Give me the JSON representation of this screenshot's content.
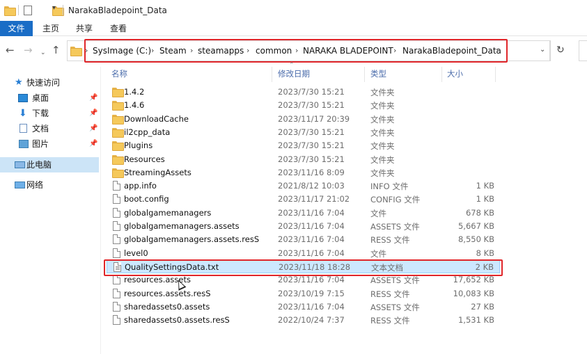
{
  "window": {
    "title": "NarakaBladepoint_Data"
  },
  "ribbon": {
    "tabs": [
      "文件",
      "主页",
      "共享",
      "查看"
    ]
  },
  "address": {
    "crumbs": [
      "SysImage (C:)",
      "Steam",
      "steamapps",
      "common",
      "NARAKA BLADEPOINT",
      "NarakaBladepoint_Data"
    ]
  },
  "sidebar": {
    "quick_access": "快速访问",
    "items": [
      {
        "label": "桌面",
        "pinned": true,
        "icon": "desktop-icon"
      },
      {
        "label": "下载",
        "pinned": true,
        "icon": "download-icon"
      },
      {
        "label": "文档",
        "pinned": true,
        "icon": "document-icon"
      },
      {
        "label": "图片",
        "pinned": true,
        "icon": "picture-icon"
      }
    ],
    "this_pc": "此电脑",
    "network": "网络"
  },
  "columns": {
    "name": "名称",
    "date": "修改日期",
    "type": "类型",
    "size": "大小"
  },
  "files": [
    {
      "name": "1.4.2",
      "date": "2023/7/30 15:21",
      "type": "文件夹",
      "size": "",
      "kind": "folder"
    },
    {
      "name": "1.4.6",
      "date": "2023/7/30 15:21",
      "type": "文件夹",
      "size": "",
      "kind": "folder"
    },
    {
      "name": "DownloadCache",
      "date": "2023/11/17 20:39",
      "type": "文件夹",
      "size": "",
      "kind": "folder"
    },
    {
      "name": "il2cpp_data",
      "date": "2023/7/30 15:21",
      "type": "文件夹",
      "size": "",
      "kind": "folder"
    },
    {
      "name": "Plugins",
      "date": "2023/7/30 15:21",
      "type": "文件夹",
      "size": "",
      "kind": "folder"
    },
    {
      "name": "Resources",
      "date": "2023/7/30 15:21",
      "type": "文件夹",
      "size": "",
      "kind": "folder"
    },
    {
      "name": "StreamingAssets",
      "date": "2023/11/16 8:09",
      "type": "文件夹",
      "size": "",
      "kind": "folder"
    },
    {
      "name": "app.info",
      "date": "2021/8/12 10:03",
      "type": "INFO 文件",
      "size": "1 KB",
      "kind": "file"
    },
    {
      "name": "boot.config",
      "date": "2023/11/17 21:02",
      "type": "CONFIG 文件",
      "size": "1 KB",
      "kind": "file"
    },
    {
      "name": "globalgamemanagers",
      "date": "2023/11/16 7:04",
      "type": "文件",
      "size": "678 KB",
      "kind": "file"
    },
    {
      "name": "globalgamemanagers.assets",
      "date": "2023/11/16 7:04",
      "type": "ASSETS 文件",
      "size": "5,667 KB",
      "kind": "file"
    },
    {
      "name": "globalgamemanagers.assets.resS",
      "date": "2023/11/16 7:04",
      "type": "RESS 文件",
      "size": "8,550 KB",
      "kind": "file"
    },
    {
      "name": "level0",
      "date": "2023/11/16 7:04",
      "type": "文件",
      "size": "8 KB",
      "kind": "file"
    },
    {
      "name": "QualitySettingsData.txt",
      "date": "2023/11/18 18:28",
      "type": "文本文档",
      "size": "2 KB",
      "kind": "txt",
      "selected": true
    },
    {
      "name": "resources.assets",
      "date": "2023/11/16 7:04",
      "type": "ASSETS 文件",
      "size": "17,652 KB",
      "kind": "file"
    },
    {
      "name": "resources.assets.resS",
      "date": "2023/10/19 7:15",
      "type": "RESS 文件",
      "size": "10,083 KB",
      "kind": "file"
    },
    {
      "name": "sharedassets0.assets",
      "date": "2023/11/16 7:04",
      "type": "ASSETS 文件",
      "size": "27 KB",
      "kind": "file"
    },
    {
      "name": "sharedassets0.assets.resS",
      "date": "2022/10/24 7:37",
      "type": "RESS 文件",
      "size": "1,531 KB",
      "kind": "file"
    }
  ],
  "colors": {
    "accent": "#1a6dc6",
    "selection": "#cce8ff",
    "highlight": "#e0262a",
    "folder": "#f5c95b"
  }
}
